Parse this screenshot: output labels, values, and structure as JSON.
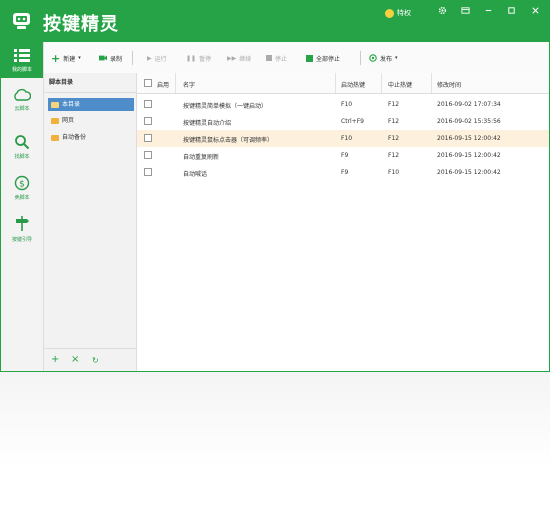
{
  "app": {
    "title": "按键精灵",
    "vip_label": "特权"
  },
  "titlebar": {
    "settings_icon": "gear-icon",
    "skin_icon": "skin-icon",
    "min_icon": "minimize-icon",
    "max_icon": "maximize-icon",
    "close_icon": "close-icon"
  },
  "sidebar": {
    "items": [
      {
        "label": "我的脚本",
        "icon": "list-icon"
      },
      {
        "label": "云脚本",
        "icon": "cloud-icon"
      },
      {
        "label": "找脚本",
        "icon": "search-icon"
      },
      {
        "label": "卖脚本",
        "icon": "dollar-icon"
      },
      {
        "label": "按键引导",
        "icon": "signpost-icon"
      }
    ]
  },
  "toolbar": {
    "new": "新建",
    "record": "录制",
    "run": "运行",
    "pause": "暂停",
    "resume": "继续",
    "stop": "停止",
    "stop_all": "全部停止",
    "publish": "发布"
  },
  "tree": {
    "header": "脚本目录",
    "items": [
      {
        "label": "本目录"
      },
      {
        "label": "网页"
      },
      {
        "label": "自动备份"
      }
    ],
    "actions": {
      "add": "+",
      "delete": "×",
      "refresh": "↻"
    }
  },
  "table": {
    "headers": {
      "enabled": "启用",
      "name": "名字",
      "start_key": "启动热键",
      "stop_key": "中止热键",
      "modified": "修改时间"
    },
    "rows": [
      {
        "name": "按键精灵简单模拟（一键启动）",
        "start": "F10",
        "stop": "F12",
        "time": "2016-09-02 17:07:34",
        "highlight": false
      },
      {
        "name": "按键精灵自动介绍",
        "start": "Ctrl+F9",
        "stop": "F12",
        "time": "2016-09-02 15:35:56",
        "highlight": false
      },
      {
        "name": "按键精灵鼠标点击器（可调频率）",
        "start": "F10",
        "stop": "F12",
        "time": "2016-09-15 12:00:42",
        "highlight": true
      },
      {
        "name": "自动重复刷新",
        "start": "F9",
        "stop": "F12",
        "time": "2016-09-15 12:00:42",
        "highlight": false
      },
      {
        "name": "自动喊话",
        "start": "F9",
        "stop": "F10",
        "time": "2016-09-15 12:00:42",
        "highlight": false
      }
    ]
  },
  "colors": {
    "brand": "#25a346",
    "selected": "#4e8dc9",
    "highlight_row": "#fdf0dd"
  }
}
